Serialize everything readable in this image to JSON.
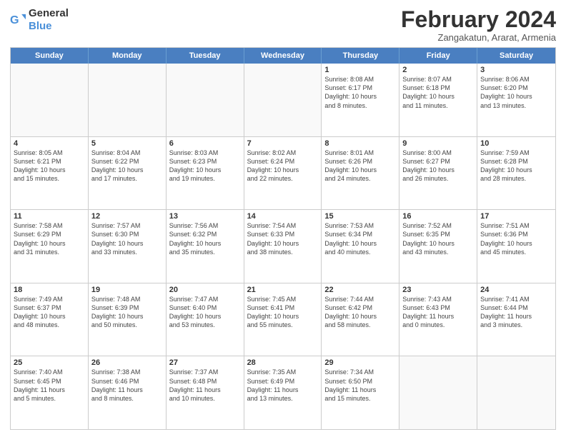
{
  "logo": {
    "general": "General",
    "blue": "Blue"
  },
  "header": {
    "title": "February 2024",
    "subtitle": "Zangakatun, Ararat, Armenia"
  },
  "days": [
    "Sunday",
    "Monday",
    "Tuesday",
    "Wednesday",
    "Thursday",
    "Friday",
    "Saturday"
  ],
  "rows": [
    [
      {
        "day": "",
        "info": ""
      },
      {
        "day": "",
        "info": ""
      },
      {
        "day": "",
        "info": ""
      },
      {
        "day": "",
        "info": ""
      },
      {
        "day": "1",
        "info": "Sunrise: 8:08 AM\nSunset: 6:17 PM\nDaylight: 10 hours\nand 8 minutes."
      },
      {
        "day": "2",
        "info": "Sunrise: 8:07 AM\nSunset: 6:18 PM\nDaylight: 10 hours\nand 11 minutes."
      },
      {
        "day": "3",
        "info": "Sunrise: 8:06 AM\nSunset: 6:20 PM\nDaylight: 10 hours\nand 13 minutes."
      }
    ],
    [
      {
        "day": "4",
        "info": "Sunrise: 8:05 AM\nSunset: 6:21 PM\nDaylight: 10 hours\nand 15 minutes."
      },
      {
        "day": "5",
        "info": "Sunrise: 8:04 AM\nSunset: 6:22 PM\nDaylight: 10 hours\nand 17 minutes."
      },
      {
        "day": "6",
        "info": "Sunrise: 8:03 AM\nSunset: 6:23 PM\nDaylight: 10 hours\nand 19 minutes."
      },
      {
        "day": "7",
        "info": "Sunrise: 8:02 AM\nSunset: 6:24 PM\nDaylight: 10 hours\nand 22 minutes."
      },
      {
        "day": "8",
        "info": "Sunrise: 8:01 AM\nSunset: 6:26 PM\nDaylight: 10 hours\nand 24 minutes."
      },
      {
        "day": "9",
        "info": "Sunrise: 8:00 AM\nSunset: 6:27 PM\nDaylight: 10 hours\nand 26 minutes."
      },
      {
        "day": "10",
        "info": "Sunrise: 7:59 AM\nSunset: 6:28 PM\nDaylight: 10 hours\nand 28 minutes."
      }
    ],
    [
      {
        "day": "11",
        "info": "Sunrise: 7:58 AM\nSunset: 6:29 PM\nDaylight: 10 hours\nand 31 minutes."
      },
      {
        "day": "12",
        "info": "Sunrise: 7:57 AM\nSunset: 6:30 PM\nDaylight: 10 hours\nand 33 minutes."
      },
      {
        "day": "13",
        "info": "Sunrise: 7:56 AM\nSunset: 6:32 PM\nDaylight: 10 hours\nand 35 minutes."
      },
      {
        "day": "14",
        "info": "Sunrise: 7:54 AM\nSunset: 6:33 PM\nDaylight: 10 hours\nand 38 minutes."
      },
      {
        "day": "15",
        "info": "Sunrise: 7:53 AM\nSunset: 6:34 PM\nDaylight: 10 hours\nand 40 minutes."
      },
      {
        "day": "16",
        "info": "Sunrise: 7:52 AM\nSunset: 6:35 PM\nDaylight: 10 hours\nand 43 minutes."
      },
      {
        "day": "17",
        "info": "Sunrise: 7:51 AM\nSunset: 6:36 PM\nDaylight: 10 hours\nand 45 minutes."
      }
    ],
    [
      {
        "day": "18",
        "info": "Sunrise: 7:49 AM\nSunset: 6:37 PM\nDaylight: 10 hours\nand 48 minutes."
      },
      {
        "day": "19",
        "info": "Sunrise: 7:48 AM\nSunset: 6:39 PM\nDaylight: 10 hours\nand 50 minutes."
      },
      {
        "day": "20",
        "info": "Sunrise: 7:47 AM\nSunset: 6:40 PM\nDaylight: 10 hours\nand 53 minutes."
      },
      {
        "day": "21",
        "info": "Sunrise: 7:45 AM\nSunset: 6:41 PM\nDaylight: 10 hours\nand 55 minutes."
      },
      {
        "day": "22",
        "info": "Sunrise: 7:44 AM\nSunset: 6:42 PM\nDaylight: 10 hours\nand 58 minutes."
      },
      {
        "day": "23",
        "info": "Sunrise: 7:43 AM\nSunset: 6:43 PM\nDaylight: 11 hours\nand 0 minutes."
      },
      {
        "day": "24",
        "info": "Sunrise: 7:41 AM\nSunset: 6:44 PM\nDaylight: 11 hours\nand 3 minutes."
      }
    ],
    [
      {
        "day": "25",
        "info": "Sunrise: 7:40 AM\nSunset: 6:45 PM\nDaylight: 11 hours\nand 5 minutes."
      },
      {
        "day": "26",
        "info": "Sunrise: 7:38 AM\nSunset: 6:46 PM\nDaylight: 11 hours\nand 8 minutes."
      },
      {
        "day": "27",
        "info": "Sunrise: 7:37 AM\nSunset: 6:48 PM\nDaylight: 11 hours\nand 10 minutes."
      },
      {
        "day": "28",
        "info": "Sunrise: 7:35 AM\nSunset: 6:49 PM\nDaylight: 11 hours\nand 13 minutes."
      },
      {
        "day": "29",
        "info": "Sunrise: 7:34 AM\nSunset: 6:50 PM\nDaylight: 11 hours\nand 15 minutes."
      },
      {
        "day": "",
        "info": ""
      },
      {
        "day": "",
        "info": ""
      }
    ]
  ]
}
